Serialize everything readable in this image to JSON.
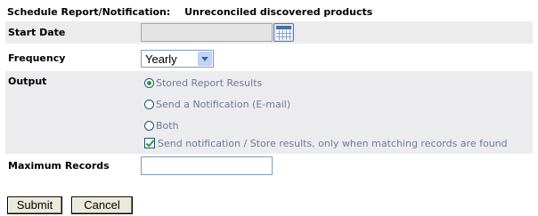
{
  "header": {
    "label": "Schedule Report/Notification:",
    "report_name": "Unreconciled discovered products"
  },
  "form": {
    "start_date": {
      "label": "Start Date",
      "value": ""
    },
    "frequency": {
      "label": "Frequency",
      "selected": "Yearly"
    },
    "output": {
      "label": "Output",
      "options": [
        {
          "label": "Stored Report Results",
          "checked": true
        },
        {
          "label": "Send a Notification (E-mail)",
          "checked": false
        },
        {
          "label": "Both",
          "checked": false
        }
      ],
      "only_when_matching": {
        "label": "Send notification / Store results, only when matching records are found",
        "checked": true
      }
    },
    "max_records": {
      "label": "Maximum Records",
      "value": ""
    }
  },
  "buttons": {
    "submit": "Submit",
    "cancel": "Cancel"
  },
  "colors": {
    "row_shade": "#ececef",
    "option_text": "#6b7a99",
    "check_accent": "#21a121"
  },
  "icons": {
    "calendar": "calendar-icon",
    "dropdown": "chevron-down-icon"
  }
}
